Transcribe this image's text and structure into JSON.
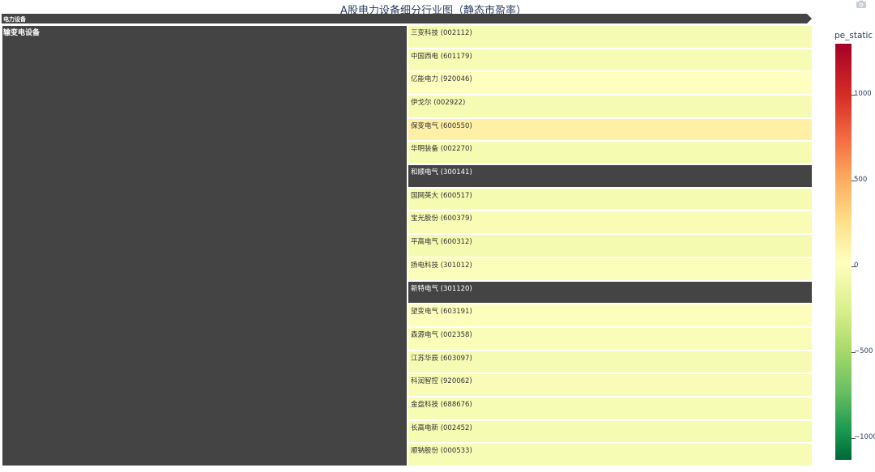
{
  "chart_data": {
    "type": "treemap",
    "title": "A股电力设备细分行业图（静态市盈率）",
    "root": "电力设备",
    "parent": "输变电设备",
    "color_metric": "pe_static",
    "colorscale": [
      "#006837",
      "#1a9850",
      "#66bd63",
      "#a6d96a",
      "#d9ef8b",
      "#ffffbf",
      "#fee08b",
      "#fdae61",
      "#f46d43",
      "#d73027",
      "#a50026"
    ],
    "colorbar": {
      "title": "pe_static",
      "min": -1130,
      "max": 1300,
      "ticks": [
        1000,
        500,
        0,
        -500,
        -1000
      ],
      "tick_labels": [
        "1000",
        "500",
        "0",
        "−500",
        "−1000"
      ]
    },
    "leaves": [
      {
        "label": "三变科技 (002112)",
        "pe_static": 30
      },
      {
        "label": "中国西电 (601179)",
        "pe_static": 35
      },
      {
        "label": "亿能电力 (920046)",
        "pe_static": 80
      },
      {
        "label": "伊戈尔 (002922)",
        "pe_static": 30
      },
      {
        "label": "保变电气 (600550)",
        "pe_static": 200
      },
      {
        "label": "华明装备 (002270)",
        "pe_static": 25
      },
      {
        "label": "和顺电气 (300141)",
        "pe_static": null
      },
      {
        "label": "国网英大 (600517)",
        "pe_static": 20
      },
      {
        "label": "宝光股份 (600379)",
        "pe_static": 40
      },
      {
        "label": "平高电气 (600312)",
        "pe_static": 15
      },
      {
        "label": "扬电科技 (301012)",
        "pe_static": 60
      },
      {
        "label": "新特电气 (301120)",
        "pe_static": null
      },
      {
        "label": "望变电气 (603191)",
        "pe_static": 70
      },
      {
        "label": "森源电气 (002358)",
        "pe_static": 50
      },
      {
        "label": "江苏华辰 (603097)",
        "pe_static": 30
      },
      {
        "label": "科润智控 (920062)",
        "pe_static": 45
      },
      {
        "label": "金盘科技 (688676)",
        "pe_static": 35
      },
      {
        "label": "长高电新 (002452)",
        "pe_static": 20
      },
      {
        "label": "顺钠股份 (000533)",
        "pe_static": 35
      }
    ]
  }
}
